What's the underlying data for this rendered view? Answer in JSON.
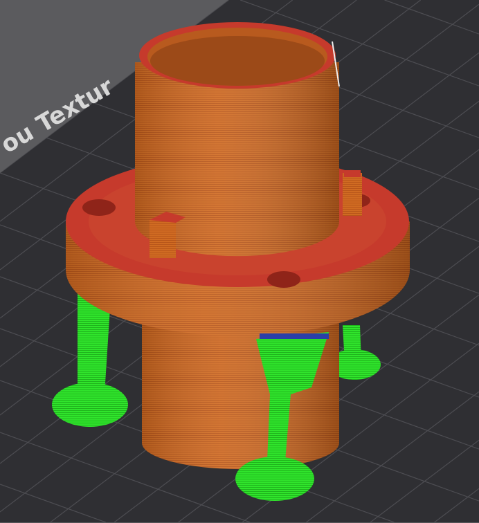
{
  "viewport": {
    "bed_label": "ou Textur",
    "colors": {
      "background": "#5b5b5e",
      "bed": "#2f2f33",
      "grid": "#4a4a4f",
      "part_wall": "#cf6a22",
      "part_top": "#c63a2c",
      "support": "#2ee02a"
    }
  }
}
